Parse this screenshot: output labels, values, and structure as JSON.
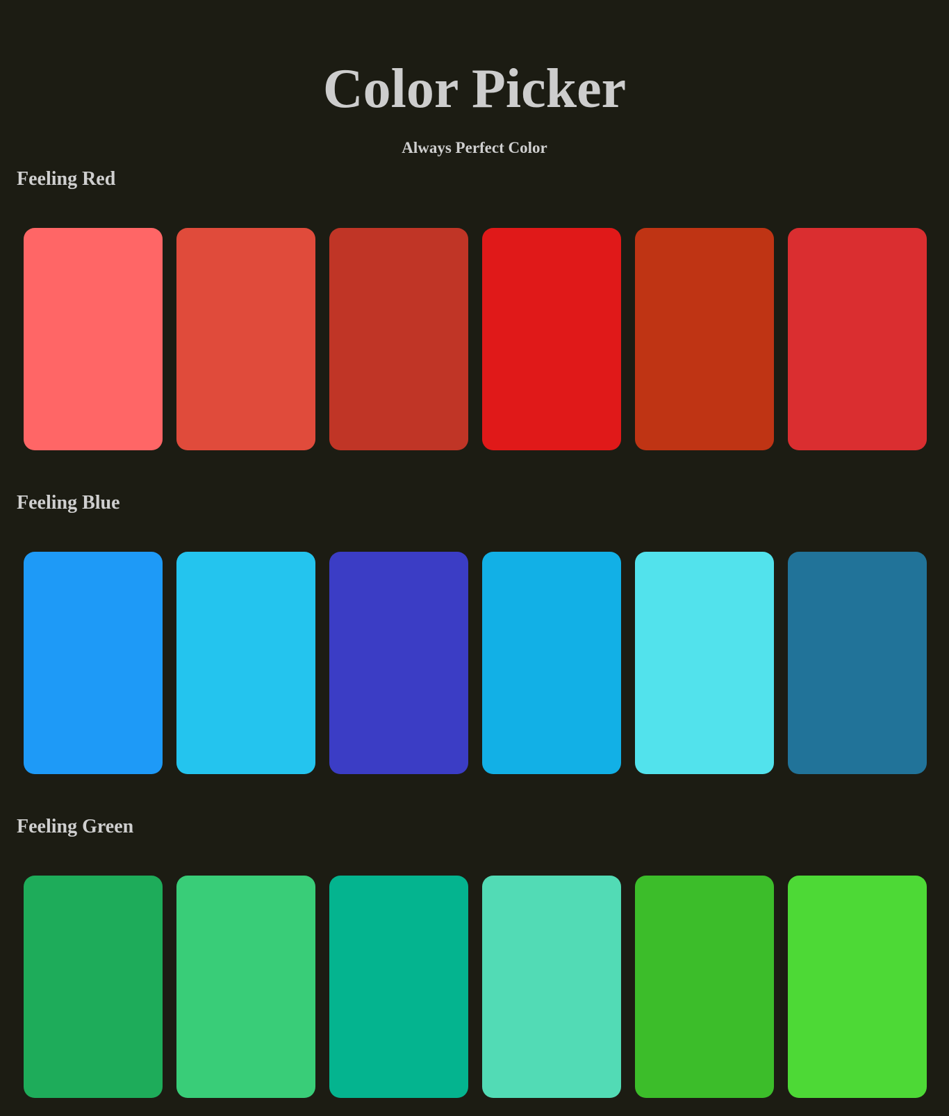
{
  "header": {
    "title": "Color Picker",
    "subtitle": "Always Perfect Color"
  },
  "sections": [
    {
      "title": "Feeling Red",
      "colors": [
        "#ff6666",
        "#e04b3b",
        "#c03526",
        "#e01919",
        "#bf3414",
        "#da2e30"
      ]
    },
    {
      "title": "Feeling Blue",
      "colors": [
        "#1e9af7",
        "#24c4ee",
        "#3b3dc5",
        "#12b0e6",
        "#52e2ec",
        "#217399"
      ]
    },
    {
      "title": "Feeling Green",
      "colors": [
        "#1eac5a",
        "#39cd78",
        "#04b48f",
        "#52dbb5",
        "#3cbd2a",
        "#4dd936"
      ]
    }
  ]
}
